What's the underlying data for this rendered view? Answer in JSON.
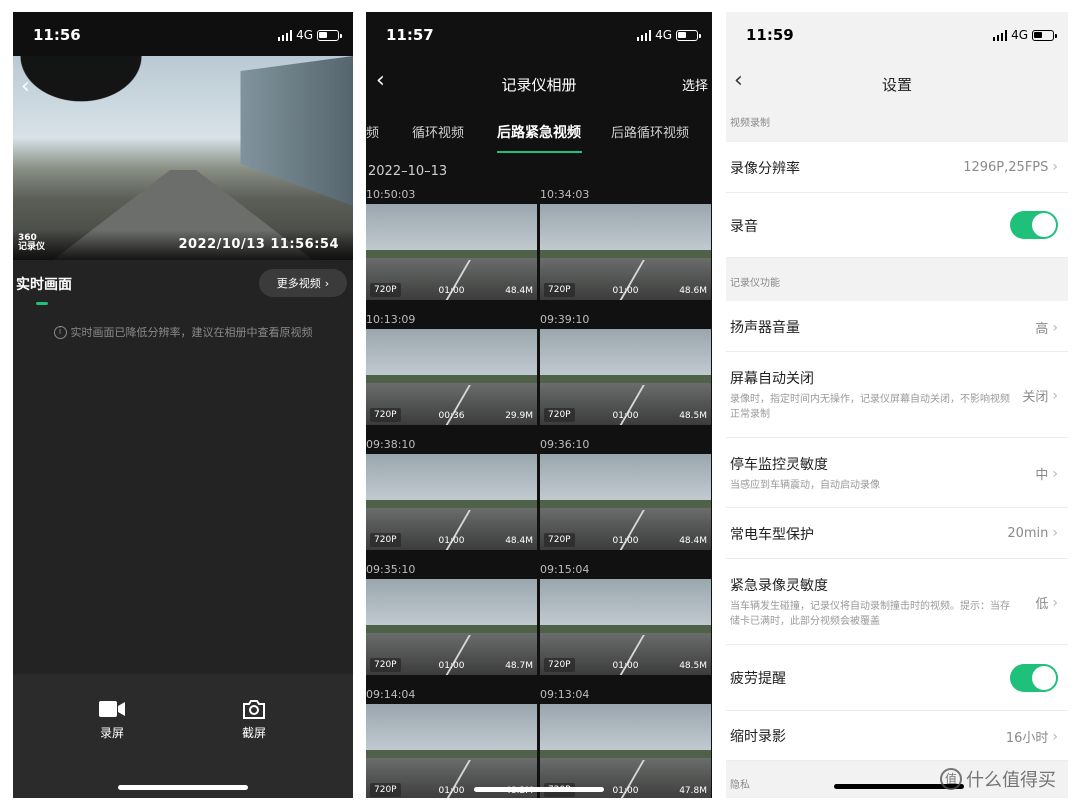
{
  "panel1": {
    "status": {
      "time": "11:56",
      "network": "4G"
    },
    "overlay": {
      "logo_line1": "360",
      "logo_line2": "记录仪",
      "timestamp": "2022/10/13  11:56:54"
    },
    "tab_label": "实时画面",
    "more_button": "更多视频",
    "hint": "实时画面已降低分辨率，建议在相册中查看原视频",
    "actions": [
      {
        "label": "录屏",
        "icon": "video-camera-icon"
      },
      {
        "label": "截屏",
        "icon": "camera-icon"
      }
    ]
  },
  "panel2": {
    "status": {
      "time": "11:57",
      "network": "4G"
    },
    "title": "记录仪相册",
    "select": "选择",
    "tabs": [
      "频",
      "循环视频",
      "后路紧急视频",
      "后路循环视频"
    ],
    "active_tab": "后路紧急视频",
    "date": "2022–10–13",
    "videos": [
      {
        "time": "10:50:03",
        "res": "720P",
        "duration": "01:00",
        "size": "48.4M"
      },
      {
        "time": "10:34:03",
        "res": "720P",
        "duration": "01:00",
        "size": "48.6M"
      },
      {
        "time": "10:13:09",
        "res": "720P",
        "duration": "00:36",
        "size": "29.9M"
      },
      {
        "time": "09:39:10",
        "res": "720P",
        "duration": "01:00",
        "size": "48.5M"
      },
      {
        "time": "09:38:10",
        "res": "720P",
        "duration": "01:00",
        "size": "48.4M"
      },
      {
        "time": "09:36:10",
        "res": "720P",
        "duration": "01:00",
        "size": "48.4M"
      },
      {
        "time": "09:35:10",
        "res": "720P",
        "duration": "01:00",
        "size": "48.7M"
      },
      {
        "time": "09:15:04",
        "res": "720P",
        "duration": "01:00",
        "size": "48.5M"
      },
      {
        "time": "09:14:04",
        "res": "720P",
        "duration": "01:00",
        "size": "48.2M"
      },
      {
        "time": "09:13:04",
        "res": "720P",
        "duration": "01:00",
        "size": "47.8M"
      }
    ]
  },
  "panel3": {
    "status": {
      "time": "11:59",
      "network": "4G"
    },
    "title": "设置",
    "section_video": "视频录制",
    "section_recorder": "记录仪功能",
    "section_privacy": "隐私",
    "resolution": {
      "label": "录像分辨率",
      "value": "1296P,25FPS"
    },
    "audio": {
      "label": "录音",
      "on": true
    },
    "speaker": {
      "label": "扬声器音量",
      "value": "高"
    },
    "screen_off": {
      "label": "屏幕自动关闭",
      "desc": "录像时，指定时间内无操作，记录仪屏幕自动关闭，不影响视频正常录制",
      "value": "关闭"
    },
    "parking": {
      "label": "停车监控灵敏度",
      "desc": "当感应到车辆震动，自动启动录像",
      "value": "中"
    },
    "battery": {
      "label": "常电车型保护",
      "value": "20min"
    },
    "emergency": {
      "label": "紧急录像灵敏度",
      "desc": "当车辆发生碰撞，记录仪将自动录制撞击时的视频。提示：当存储卡已满时，此部分视频会被覆盖",
      "value": "低"
    },
    "fatigue": {
      "label": "疲劳提醒",
      "on": true
    },
    "timelapse": {
      "label": "缩时录影",
      "value": "16小时"
    }
  },
  "watermark": {
    "icon_text": "值",
    "text": "什么值得买"
  }
}
